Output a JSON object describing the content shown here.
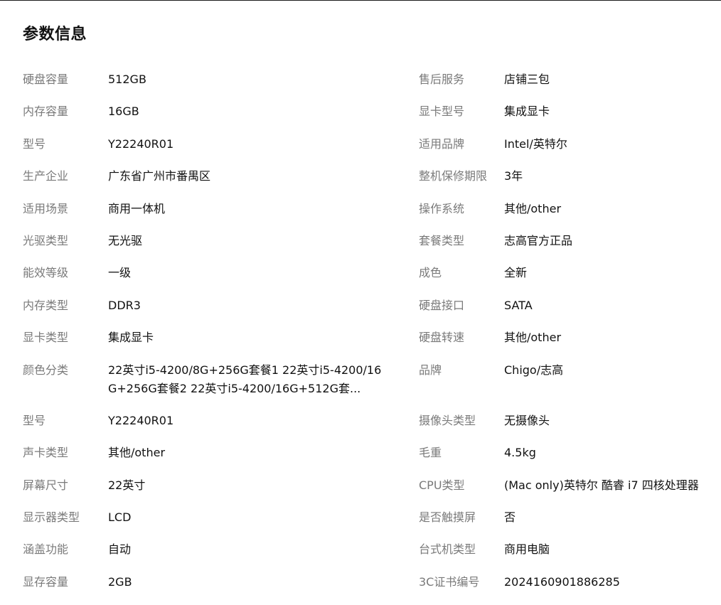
{
  "section_title": "参数信息",
  "params": {
    "left": [
      {
        "label": "硬盘容量",
        "value": "512GB"
      },
      {
        "label": "内存容量",
        "value": "16GB"
      },
      {
        "label": "型号",
        "value": "Y22240R01"
      },
      {
        "label": "生产企业",
        "value": "广东省广州市番禺区"
      },
      {
        "label": "适用场景",
        "value": "商用一体机"
      },
      {
        "label": "光驱类型",
        "value": "无光驱"
      },
      {
        "label": "能效等级",
        "value": "一级"
      },
      {
        "label": "内存类型",
        "value": "DDR3"
      },
      {
        "label": "显卡类型",
        "value": "集成显卡"
      },
      {
        "label": "颜色分类",
        "value": "22英寸i5-4200/8G+256G套餐1 22英寸i5-4200/16G+256G套餐2 22英寸i5-4200/16G+512G套..."
      },
      {
        "label": "型号",
        "value": "Y22240R01"
      },
      {
        "label": "声卡类型",
        "value": "其他/other"
      },
      {
        "label": "屏幕尺寸",
        "value": "22英寸"
      },
      {
        "label": "显示器类型",
        "value": "LCD"
      },
      {
        "label": "涵盖功能",
        "value": "自动"
      },
      {
        "label": "显存容量",
        "value": "2GB"
      }
    ],
    "right": [
      {
        "label": "售后服务",
        "value": "店铺三包"
      },
      {
        "label": "显卡型号",
        "value": "集成显卡"
      },
      {
        "label": "适用品牌",
        "value": "Intel/英特尔"
      },
      {
        "label": "整机保修期限",
        "value": "3年"
      },
      {
        "label": "操作系统",
        "value": "其他/other"
      },
      {
        "label": "套餐类型",
        "value": "志高官方正品"
      },
      {
        "label": "成色",
        "value": "全新"
      },
      {
        "label": "硬盘接口",
        "value": "SATA"
      },
      {
        "label": "硬盘转速",
        "value": "其他/other"
      },
      {
        "label": "品牌",
        "value": "Chigo/志高"
      },
      {
        "label": "摄像头类型",
        "value": "无摄像头"
      },
      {
        "label": "毛重",
        "value": "4.5kg"
      },
      {
        "label": "CPU类型",
        "value": "(Mac only)英特尔 酷睿 i7 四核处理器"
      },
      {
        "label": "是否触摸屏",
        "value": "否"
      },
      {
        "label": "台式机类型",
        "value": "商用电脑"
      },
      {
        "label": "3C证书编号",
        "value": "2024160901886285"
      }
    ]
  }
}
